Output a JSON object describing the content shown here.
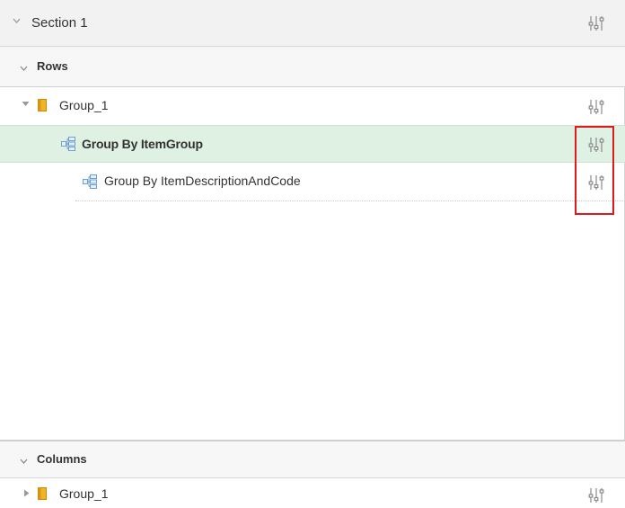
{
  "section": {
    "title": "Section 1",
    "caret_icon": "caret-down-icon",
    "settings_icon": "sliders-icon"
  },
  "rows_panel": {
    "title": "Rows",
    "caret_icon": "caret-down-icon",
    "tree": [
      {
        "label": "Group_1",
        "icon": "folder-icon",
        "expander": "caret-down-icon",
        "settings_icon": "sliders-icon"
      },
      {
        "label": "Group By ItemGroup",
        "icon": "group-by-icon",
        "selected": true,
        "settings_icon": "sliders-icon"
      },
      {
        "label": "Group By ItemDescriptionAndCode",
        "icon": "group-by-icon",
        "settings_icon": "sliders-icon"
      }
    ]
  },
  "columns_panel": {
    "title": "Columns",
    "caret_icon": "caret-down-icon",
    "tree": [
      {
        "label": "Group_1",
        "icon": "folder-icon",
        "expander": "caret-right-icon",
        "settings_icon": "sliders-icon"
      }
    ]
  },
  "colors": {
    "selected_row": "#dff1e3",
    "highlight_box": "#e0191d",
    "folder": "#e3a21a",
    "group_icon": "#7aa9d6",
    "settings_icon": "#8a8a8a"
  }
}
